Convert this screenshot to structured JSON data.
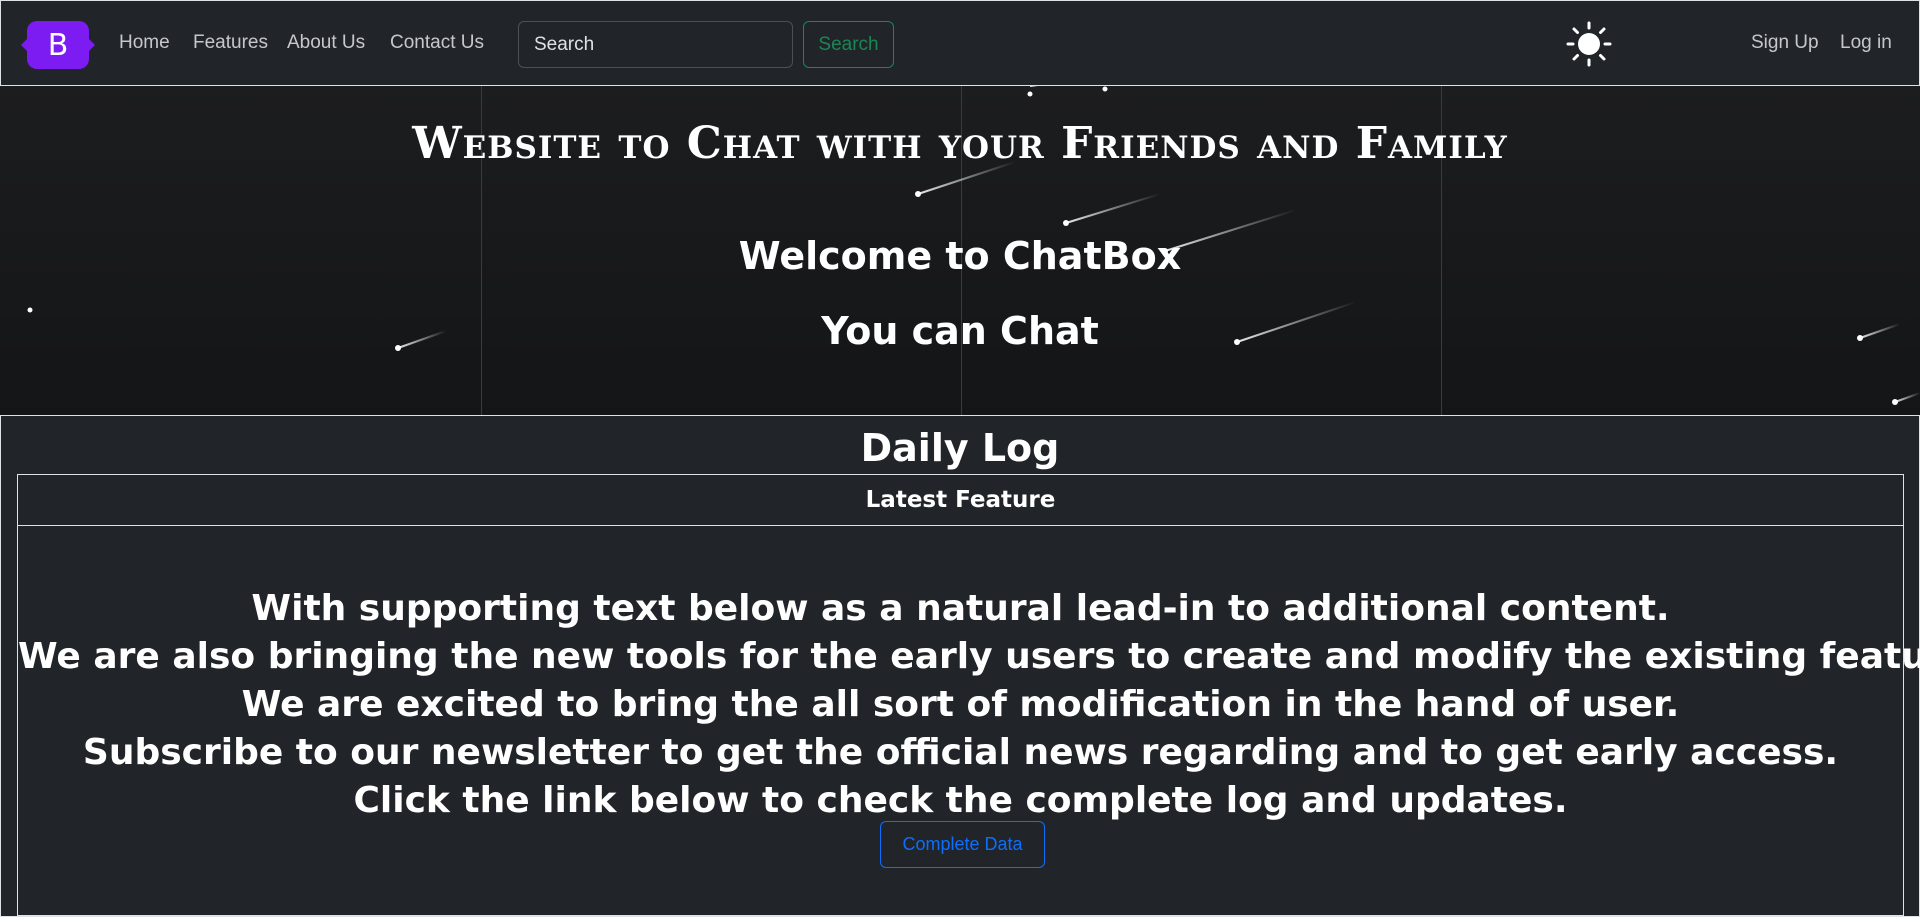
{
  "navbar": {
    "brand": "B",
    "links": [
      "Home",
      "Features",
      "About Us",
      "Contact Us"
    ],
    "search_placeholder": "Search",
    "search_button": "Search",
    "theme_icon": "sun-icon",
    "sign_up": "Sign Up",
    "log_in": "Log in"
  },
  "hero": {
    "title": "Website to Chat with your Friends and Family",
    "welcome": "Welcome to ChatBox",
    "tagline": "You can Chat"
  },
  "daily_log": {
    "title": "Daily Log",
    "card_header": "Latest Feature",
    "lines": [
      "With supporting text below as a natural lead-in to additional content.",
      "We are also bringing the new tools for the early users to create and modify the existing feature.",
      "We are excited to bring the all sort of modification in the hand of user.",
      "Subscribe to our newsletter to get the official news regarding and to get early access.",
      "Click the link below to check the complete log and updates."
    ],
    "button": "Complete Data"
  },
  "colors": {
    "brand": "#7c1cf2",
    "background": "#212529",
    "success": "#198754",
    "primary": "#0d6efd"
  }
}
